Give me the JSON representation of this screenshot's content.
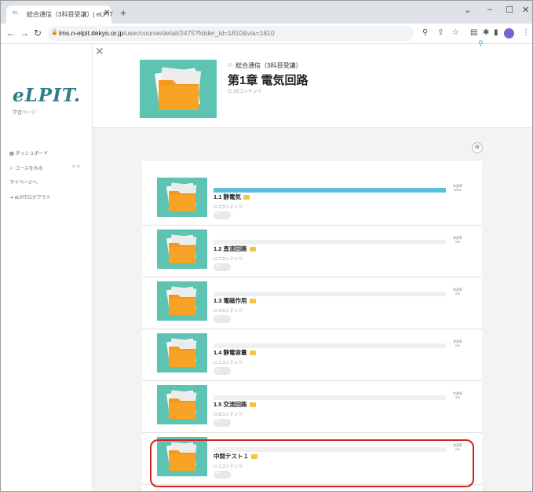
{
  "browser": {
    "tab_title": "総合通信（3科目受講）| eLPIT",
    "url_host": "lms.n-elpit.dekyo.or.jp",
    "url_path": "/user/course/detail/2475?folder_id=1810&via=1810",
    "tab_favicon": "eL"
  },
  "sidebar": {
    "logo": "eLPIT.",
    "logo_subtitle": "学習ページ",
    "items": [
      {
        "icon": "dashboard-icon",
        "label": "ダッシュボード"
      },
      {
        "icon": "course-icon",
        "label": "コースをみる"
      },
      {
        "icon": "",
        "label": "マイページへ"
      },
      {
        "icon": "logout-icon",
        "label": "eLPITログアウト"
      }
    ],
    "expand_arrow": "> >"
  },
  "header": {
    "course_name": "総合通信（3科目受講）",
    "chapter_title": "第1章 電気回路",
    "content_count": "23コンテンツ"
  },
  "items": [
    {
      "title": "1.1 静電気",
      "count": "2コンテンツ",
      "progress_label": "学習率",
      "progress": 100,
      "progress_text": "100%"
    },
    {
      "title": "1.2 直流回路",
      "count": "7コンテンツ",
      "progress_label": "学習率",
      "progress": 0,
      "progress_text": "0%"
    },
    {
      "title": "1.3 電磁作用",
      "count": "4コンテンツ",
      "progress_label": "学習率",
      "progress": 0,
      "progress_text": "0%"
    },
    {
      "title": "1.4 静電容量",
      "count": "1コンテンツ",
      "progress_label": "学習率",
      "progress": 0,
      "progress_text": "0%"
    },
    {
      "title": "1.5 交流回路",
      "count": "8コンテンツ",
      "progress_label": "学習率",
      "progress": 0,
      "progress_text": "0%"
    },
    {
      "title": "中間テスト１",
      "count": "1コンテンツ",
      "progress_label": "学習率",
      "progress": 0,
      "progress_text": "0%"
    }
  ],
  "colors": {
    "accent": "#2d7e88",
    "thumb_bg": "#5dc4b4",
    "folder": "#f39a1e",
    "progress": "#5bc0de",
    "highlight": "#d42222"
  }
}
